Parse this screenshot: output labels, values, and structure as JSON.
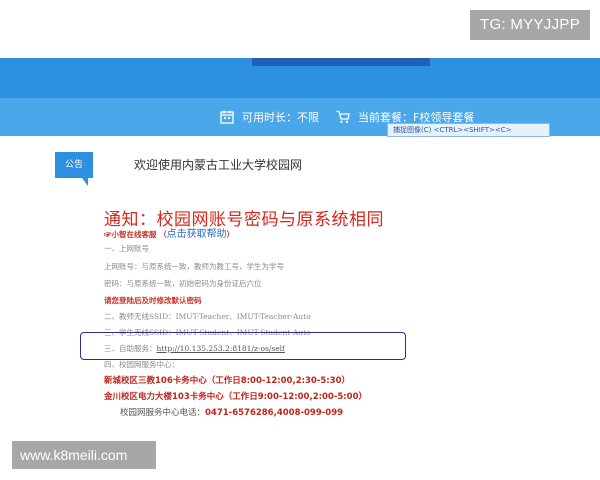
{
  "watermark_top": "TG: MYYJJPP",
  "watermark_bottom": "www.k8meili.com",
  "status_bar": {
    "duration_label": "可用时长：",
    "duration_value": "不限",
    "package_label": "当前套餐：",
    "package_value": "F校领导套餐"
  },
  "capture_tip": "捕捉图像(C)   <CTRL><SHIFT><C>",
  "notice": {
    "tag": "公告",
    "welcome": "欢迎使用内蒙古工业大学校园网",
    "title": "通知：校园网账号密码与原系统相同",
    "help_prefix": "☞小智在线客服 （",
    "help_link": "点击获取帮助",
    "help_suffix": "）",
    "lines": [
      "一、上网账号",
      "上网账号：与原系统一致，教师为教工号，学生为学号",
      "密码：与原系统一致，初始密码为身份证后六位",
      "请您登陆后及时修改默认密码",
      "二、教师无线SSID：IMUT-Teacher、IMUT-Teacher-Auto",
      "三、学生无线SSID：IMUT-Student、IMUT-Student-Auto",
      "三、自助服务：",
      "四、校园网服务中心："
    ],
    "self_service_url": "http://10.135.253.2:8181/z-os/self",
    "locations": [
      "新城校区三教106卡务中心（工作日8:00-12:00,2:30-5:30）",
      "金川校区电力大楼103卡务中心（工作日9:00-12:00,2:00-5:00）"
    ],
    "service_label": "校园网服务中心电话：",
    "service_phone": "0471-6576286,4008-099-099"
  }
}
